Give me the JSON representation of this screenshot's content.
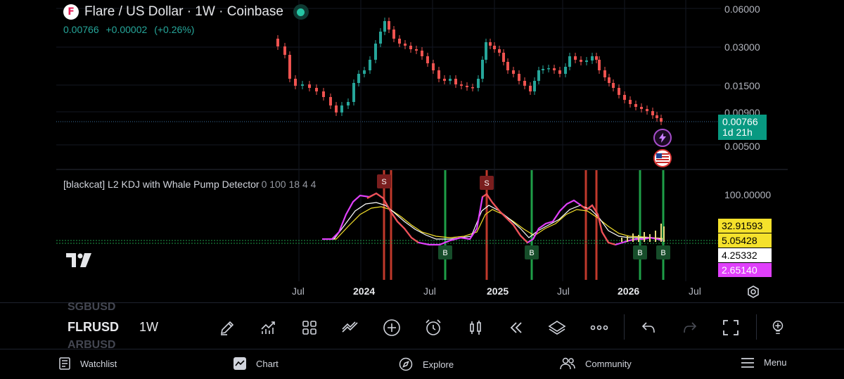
{
  "header": {
    "logo_letter": "F",
    "title": "Flare / US Dollar · 1W · Coinbase",
    "price": "0.00766",
    "change": "+0.00002",
    "change_pct": "(+0.26%)"
  },
  "price_axis": {
    "labels": [
      "0.06000",
      "0.03000",
      "0.01500",
      "0.00900",
      "0.00500"
    ],
    "last_price": "0.00766",
    "countdown": "1d 21h"
  },
  "indicator": {
    "title": "[blackcat] L2 KDJ with Whale Pump Detector",
    "params": "0 100 18 4 4",
    "axis_label": "100.00000",
    "values": [
      {
        "text": "32.91593",
        "bg": "#f5e12b",
        "fg": "#000000"
      },
      {
        "text": "5.05428",
        "bg": "#f5e12b",
        "fg": "#000000"
      },
      {
        "text": "4.25332",
        "bg": "#ffffff",
        "fg": "#000000"
      },
      {
        "text": "2.65140",
        "bg": "#e040fb",
        "fg": "#ffffff"
      }
    ],
    "sell_label": "S",
    "buy_label": "B"
  },
  "time_axis": {
    "labels": [
      "Jul",
      "2024",
      "Jul",
      "2025",
      "Jul",
      "2026",
      "Jul"
    ]
  },
  "toolbar": {
    "ghost_above": "SGBUSD",
    "symbol": "FLRUSD",
    "ghost_below": "ARBUSD",
    "interval": "1W",
    "icons": [
      "pencil-icon",
      "indicators-icon",
      "templates-icon",
      "compare-icon",
      "plus-circle-icon",
      "alert-icon",
      "candles-icon",
      "replay-icon",
      "layers-icon",
      "more-icon",
      "undo-icon",
      "redo-icon",
      "fullscreen-icon",
      "idea-icon"
    ]
  },
  "bottom_nav": {
    "watchlist": "Watchlist",
    "chart": "Chart",
    "explore": "Explore",
    "community": "Community",
    "menu": "Menu"
  },
  "colors": {
    "up": "#26a69a",
    "down": "#ef5350",
    "magenta": "#e040fb",
    "yellow": "#f5e12b",
    "white": "#ffffff",
    "sell_bar": "#c0392b",
    "buy_bar": "#1e9e47"
  }
}
